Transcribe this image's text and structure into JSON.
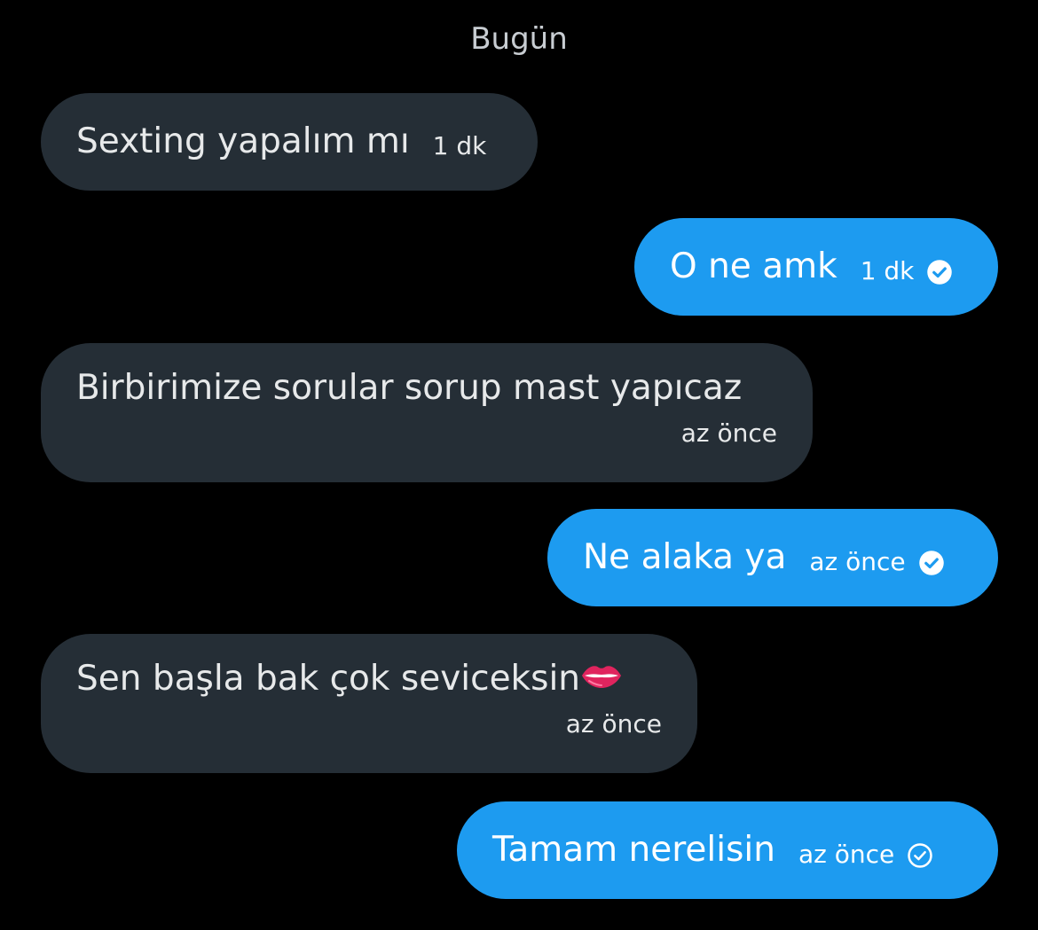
{
  "date_header": "Bugün",
  "messages": [
    {
      "direction": "incoming",
      "text": "Sexting yapalım mı",
      "time": "1 dk"
    },
    {
      "direction": "outgoing",
      "text": "O ne amk",
      "time": "1 dk",
      "status": "read",
      "status_icon": "filled-check-circle-icon"
    },
    {
      "direction": "incoming",
      "text": "Birbirimize sorular sorup mast yapıcaz",
      "time": "az önce"
    },
    {
      "direction": "outgoing",
      "text": "Ne alaka ya",
      "time": "az önce",
      "status": "read",
      "status_icon": "filled-check-circle-icon"
    },
    {
      "direction": "incoming",
      "text": "Sen başla bak çok seviceksin",
      "emoji": "lips",
      "time": "az önce"
    },
    {
      "direction": "outgoing",
      "text": "Tamam nerelisin",
      "time": "az önce",
      "status": "sent",
      "status_icon": "outline-check-circle-icon"
    }
  ],
  "colors": {
    "background": "#000000",
    "incoming_bubble": "#252e36",
    "outgoing_bubble": "#1d9bf0",
    "text": "#e7e9ea"
  }
}
